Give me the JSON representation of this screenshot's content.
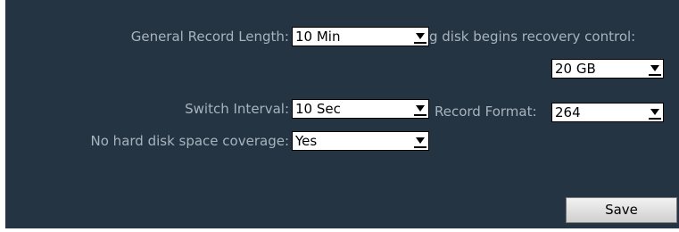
{
  "form": {
    "general_record_length": {
      "label": "General Record Length:",
      "value": "10 Min"
    },
    "recovery_control": {
      "label": "g disk begins recovery control:",
      "value": "20 GB"
    },
    "switch_interval": {
      "label": "Switch Interval:",
      "value": "10 Sec"
    },
    "record_format": {
      "label": "Record Format:",
      "value": "264"
    },
    "no_disk_space": {
      "label": "No hard disk space coverage:",
      "value": "Yes"
    },
    "save_label": "Save"
  },
  "colors": {
    "panel_bg": "#243442",
    "label_text": "#a8b3bd"
  },
  "icons": {
    "select_arrow": "chevron-down-icon"
  }
}
